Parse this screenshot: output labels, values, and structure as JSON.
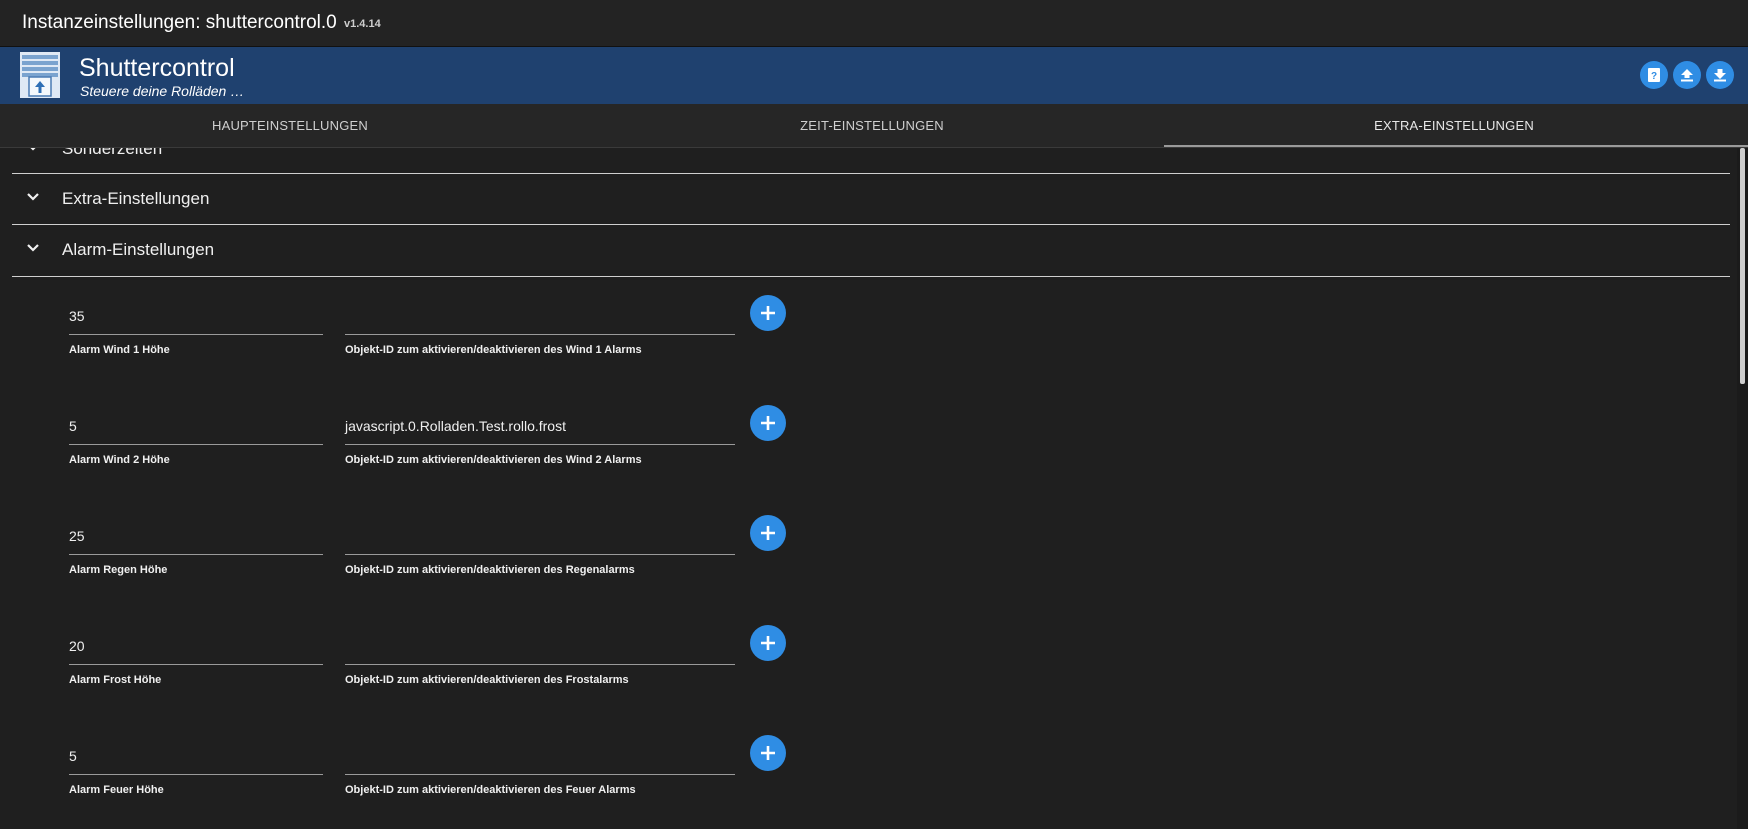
{
  "window": {
    "title": "Instanzeinstellungen: shuttercontrol.0",
    "version": "v1.4.14"
  },
  "header": {
    "app_title": "Shuttercontrol",
    "app_subtitle": "Steuere deine Rolläden …",
    "buttons": [
      "help-icon",
      "upload-icon",
      "download-icon"
    ],
    "accent_color": "#1f416f",
    "button_color": "#2f8de4"
  },
  "tabs": [
    {
      "label": "HAUPTEINSTELLUNGEN",
      "active": false
    },
    {
      "label": "ZEIT-EINSTELLUNGEN",
      "active": false
    },
    {
      "label": "EXTRA-EINSTELLUNGEN",
      "active": true
    }
  ],
  "sections": [
    {
      "label": "Sonderzeiten"
    },
    {
      "label": "Extra-Einstellungen"
    },
    {
      "label": "Alarm-Einstellungen"
    }
  ],
  "alarms": [
    {
      "value": "35",
      "value_label": "Alarm Wind 1 Höhe",
      "object_id": "",
      "object_label": "Objekt-ID zum aktivieren/deaktivieren des Wind 1 Alarms"
    },
    {
      "value": "5",
      "value_label": "Alarm Wind 2 Höhe",
      "object_id": "javascript.0.Rolladen.Test.rollo.frost",
      "object_label": "Objekt-ID zum aktivieren/deaktivieren des Wind 2 Alarms"
    },
    {
      "value": "25",
      "value_label": "Alarm Regen Höhe",
      "object_id": "",
      "object_label": "Objekt-ID zum aktivieren/deaktivieren des Regenalarms"
    },
    {
      "value": "20",
      "value_label": "Alarm Frost Höhe",
      "object_id": "",
      "object_label": "Objekt-ID zum aktivieren/deaktivieren des Frostalarms"
    },
    {
      "value": "5",
      "value_label": "Alarm Feuer Höhe",
      "object_id": "",
      "object_label": "Objekt-ID zum aktivieren/deaktivieren des Feuer Alarms"
    }
  ]
}
